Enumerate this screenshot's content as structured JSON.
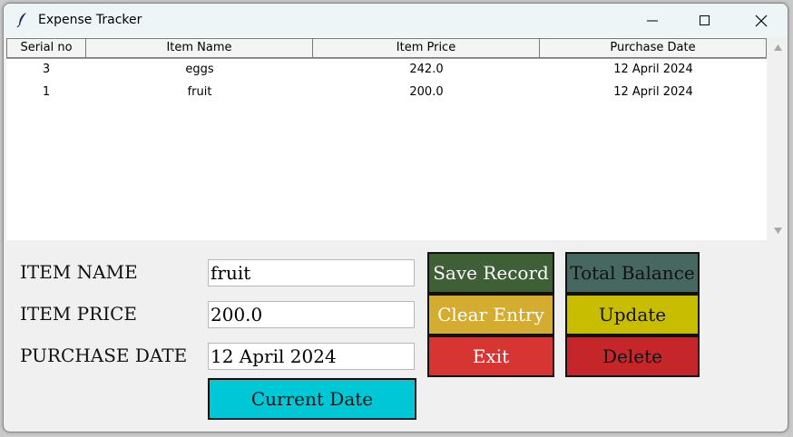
{
  "window": {
    "title": "Expense Tracker"
  },
  "table": {
    "headers": [
      "Serial no",
      "Item Name",
      "Item Price",
      "Purchase Date"
    ],
    "rows": [
      {
        "serial": "3",
        "name": "eggs",
        "price": "242.0",
        "date": "12 April 2024"
      },
      {
        "serial": "1",
        "name": "fruit",
        "price": "200.0",
        "date": "12 April 2024"
      }
    ]
  },
  "form": {
    "item_name_label": "ITEM NAME",
    "item_price_label": "ITEM PRICE",
    "purchase_date_label": "PURCHASE DATE",
    "item_name_value": "fruit",
    "item_price_value": "200.0",
    "purchase_date_value": "12 April 2024"
  },
  "buttons": {
    "current_date": "Current Date",
    "save_record": "Save Record",
    "clear_entry": "Clear Entry",
    "exit": "Exit",
    "total_balance": "Total Balance",
    "update": "Update",
    "delete": "Delete"
  },
  "colors": {
    "save_record": "#3f5f37",
    "clear_entry": "#d4ac2f",
    "exit": "#d73532",
    "total_balance": "#466861",
    "update": "#c8bd00",
    "delete": "#c4262a",
    "current_date": "#00c7d6"
  },
  "icons": {
    "app": "feather-icon",
    "minimize": "minimize-icon",
    "maximize": "maximize-icon",
    "close": "close-icon"
  }
}
